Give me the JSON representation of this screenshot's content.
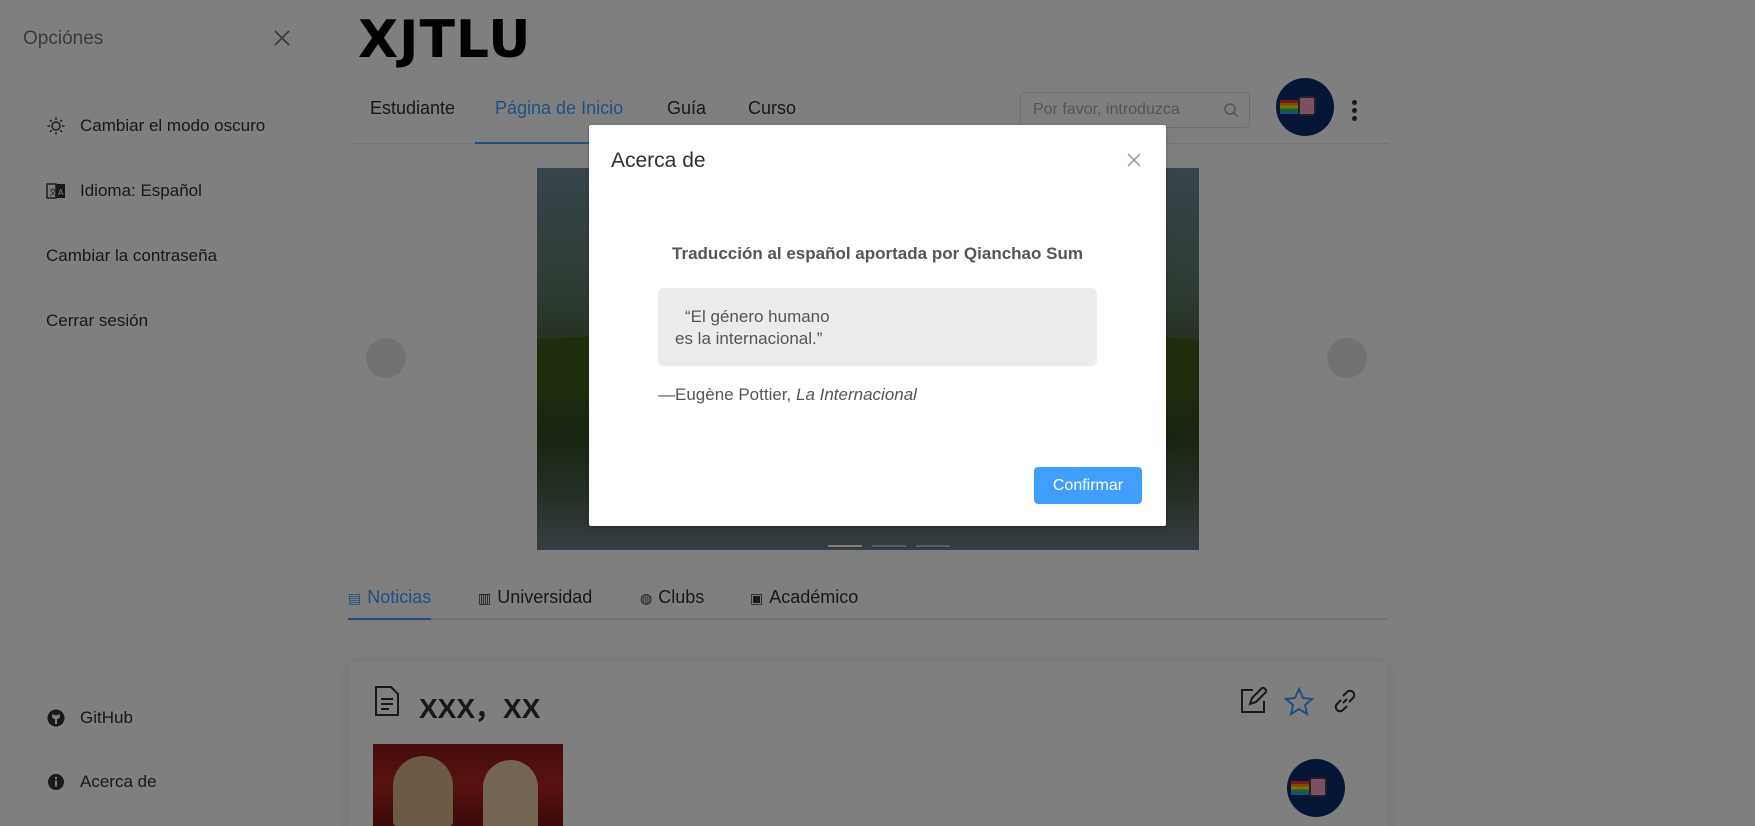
{
  "app": {
    "logo": "XJTLU",
    "nav_tabs": [
      {
        "label": "Estudiante"
      },
      {
        "label": "Página de Inicio"
      },
      {
        "label": "Guía"
      },
      {
        "label": "Curso"
      }
    ],
    "active_tab": "Página de Inicio",
    "search": {
      "placeholder": "Por favor, introduzca",
      "value": ""
    },
    "carousel": {
      "slide_count": 3,
      "active_index": 0
    },
    "sub_tabs": [
      {
        "label": "Noticias",
        "icon": "document-icon"
      },
      {
        "label": "Universidad",
        "icon": "building-icon"
      },
      {
        "label": "Clubs",
        "icon": "medal-icon"
      },
      {
        "label": "Académico",
        "icon": "cap-icon"
      }
    ],
    "active_sub_tab": "Noticias",
    "post": {
      "title": "XXX，XX"
    },
    "colors": {
      "accent": "#409eff",
      "text": "#303133"
    }
  },
  "drawer": {
    "title": "Opciónes",
    "items": [
      {
        "label": "Cambiar el modo oscuro",
        "icon": "sun-icon"
      },
      {
        "label": "Idioma: Español",
        "icon": "translate-icon"
      },
      {
        "label": "Cambiar la contraseña",
        "icon": ""
      },
      {
        "label": "Cerrar sesión",
        "icon": ""
      }
    ],
    "bottom_items": [
      {
        "label": "GitHub",
        "icon": "github-icon"
      },
      {
        "label": "Acerca de",
        "icon": "info-icon"
      }
    ]
  },
  "modal": {
    "title": "Acerca de",
    "credit": "Traducción al español aportada por Qianchao Sum",
    "quote_line1": "“El género humano",
    "quote_line2": "es la internacional.”",
    "attribution_author": "—Eugène Pottier, ",
    "attribution_work": "La Internacional",
    "confirm_label": "Confirmar"
  }
}
